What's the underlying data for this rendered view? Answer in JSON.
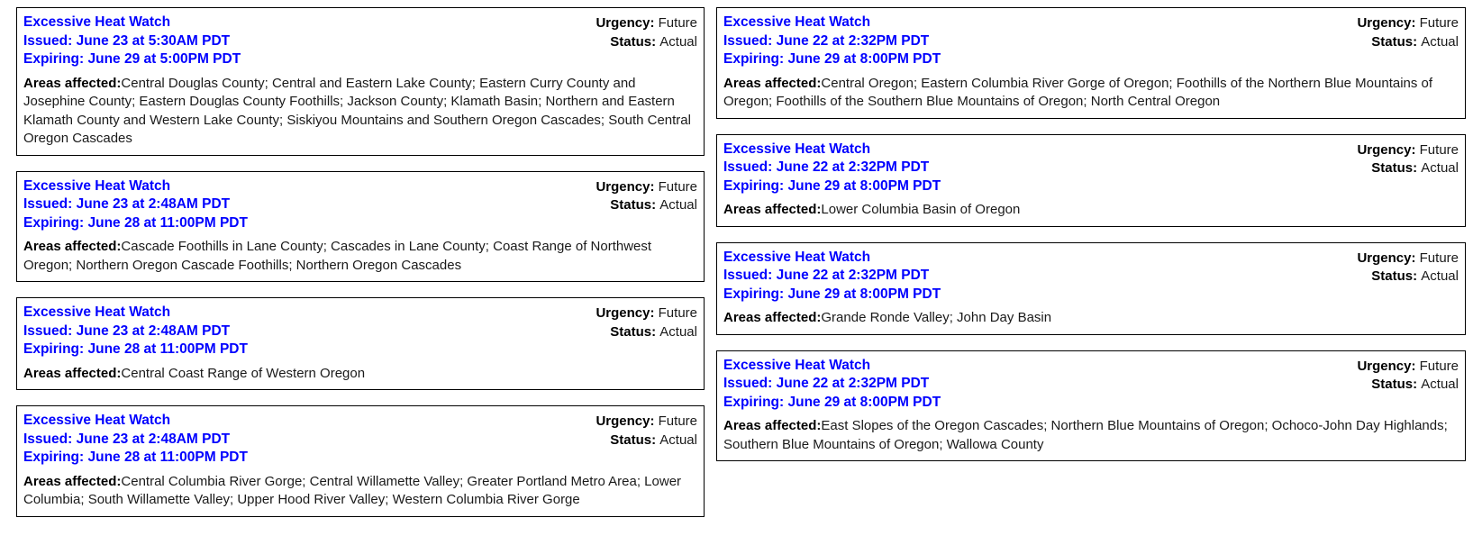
{
  "labels": {
    "urgency_key": "Urgency:",
    "status_key": "Status:",
    "areas_key": "Areas affected:"
  },
  "colors": {
    "headline": "#0000FF",
    "body": "#1A1A1A",
    "border": "#000000",
    "background": "#FFFFFF"
  },
  "columns": {
    "left": [
      {
        "event": "Excessive Heat Watch",
        "issued": "Issued: June 23 at 5:30AM PDT",
        "expiring": "Expiring: June 29 at 5:00PM PDT",
        "urgency": "Future",
        "status": "Actual",
        "areas": "Central Douglas County; Central and Eastern Lake County; Eastern Curry County and Josephine County; Eastern Douglas County Foothills; Jackson County; Klamath Basin; Northern and Eastern Klamath County and Western Lake County; Siskiyou Mountains and Southern Oregon Cascades; South Central Oregon Cascades"
      },
      {
        "event": "Excessive Heat Watch",
        "issued": "Issued: June 23 at 2:48AM PDT",
        "expiring": "Expiring: June 28 at 11:00PM PDT",
        "urgency": "Future",
        "status": "Actual",
        "areas": "Cascade Foothills in Lane County; Cascades in Lane County; Coast Range of Northwest Oregon; Northern Oregon Cascade Foothills; Northern Oregon Cascades"
      },
      {
        "event": "Excessive Heat Watch",
        "issued": "Issued: June 23 at 2:48AM PDT",
        "expiring": "Expiring: June 28 at 11:00PM PDT",
        "urgency": "Future",
        "status": "Actual",
        "areas": "Central Coast Range of Western Oregon"
      },
      {
        "event": "Excessive Heat Watch",
        "issued": "Issued: June 23 at 2:48AM PDT",
        "expiring": "Expiring: June 28 at 11:00PM PDT",
        "urgency": "Future",
        "status": "Actual",
        "areas": "Central Columbia River Gorge; Central Willamette Valley; Greater Portland Metro Area; Lower Columbia; South Willamette Valley; Upper Hood River Valley; Western Columbia River Gorge"
      }
    ],
    "right": [
      {
        "event": "Excessive Heat Watch",
        "issued": "Issued: June 22 at 2:32PM PDT",
        "expiring": "Expiring: June 29 at 8:00PM PDT",
        "urgency": "Future",
        "status": "Actual",
        "areas": "Central Oregon; Eastern Columbia River Gorge of Oregon; Foothills of the Northern Blue Mountains of Oregon; Foothills of the Southern Blue Mountains of Oregon; North Central Oregon"
      },
      {
        "event": "Excessive Heat Watch",
        "issued": "Issued: June 22 at 2:32PM PDT",
        "expiring": "Expiring: June 29 at 8:00PM PDT",
        "urgency": "Future",
        "status": "Actual",
        "areas": "Lower Columbia Basin of Oregon"
      },
      {
        "event": "Excessive Heat Watch",
        "issued": "Issued: June 22 at 2:32PM PDT",
        "expiring": "Expiring: June 29 at 8:00PM PDT",
        "urgency": "Future",
        "status": "Actual",
        "areas": "Grande Ronde Valley; John Day Basin"
      },
      {
        "event": "Excessive Heat Watch",
        "issued": "Issued: June 22 at 2:32PM PDT",
        "expiring": "Expiring: June 29 at 8:00PM PDT",
        "urgency": "Future",
        "status": "Actual",
        "areas": "East Slopes of the Oregon Cascades; Northern Blue Mountains of Oregon; Ochoco-John Day Highlands; Southern Blue Mountains of Oregon; Wallowa County"
      }
    ]
  }
}
